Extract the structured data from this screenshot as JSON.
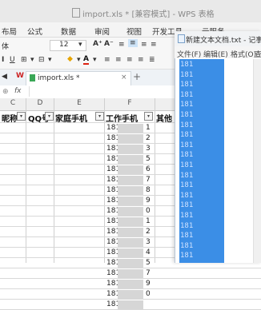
{
  "wps": {
    "title": "import.xls * [兼容模式] - WPS 表格",
    "menu": [
      "布局",
      "公式",
      "数据",
      "审阅",
      "视图",
      "开发工具",
      "云服务"
    ],
    "font_name": "体",
    "font_size": "12",
    "tab_label": "import.xls *",
    "fx_label": "fx"
  },
  "sheet": {
    "columns": [
      "C",
      "D",
      "E",
      "F"
    ],
    "headers": [
      "昵称",
      "QQ号",
      "家庭手机",
      "工作手机",
      "其他"
    ],
    "rows": [
      {
        "prefix": "181",
        "last": "1"
      },
      {
        "prefix": "181",
        "last": "2"
      },
      {
        "prefix": "181",
        "last": "3"
      },
      {
        "prefix": "181",
        "last": "5"
      },
      {
        "prefix": "181",
        "last": "6"
      },
      {
        "prefix": "181",
        "last": "7"
      },
      {
        "prefix": "181",
        "last": "8"
      },
      {
        "prefix": "181",
        "last": "9"
      },
      {
        "prefix": "181",
        "last": "0"
      },
      {
        "prefix": "181",
        "last": "1"
      },
      {
        "prefix": "181",
        "last": "2"
      },
      {
        "prefix": "181",
        "last": "3"
      },
      {
        "prefix": "181",
        "last": "4"
      },
      {
        "prefix": "181",
        "last": "5"
      },
      {
        "prefix": "181",
        "last": "7"
      },
      {
        "prefix": "181",
        "last": "9"
      },
      {
        "prefix": "181",
        "last": "0"
      },
      {
        "prefix": "181",
        "last": ""
      }
    ]
  },
  "notepad": {
    "title": "新建文本文档.txt - 记事本",
    "menu": [
      "文件(F)",
      "编辑(E)",
      "格式(O)",
      "查"
    ],
    "lines": [
      "181",
      "181",
      "181",
      "181",
      "181",
      "181",
      "181",
      "181",
      "181",
      "181",
      "181",
      "181",
      "181",
      "181",
      "181",
      "181",
      "181",
      "181",
      "181",
      "181"
    ]
  },
  "colors": {
    "selection": "#3b8ee6"
  }
}
